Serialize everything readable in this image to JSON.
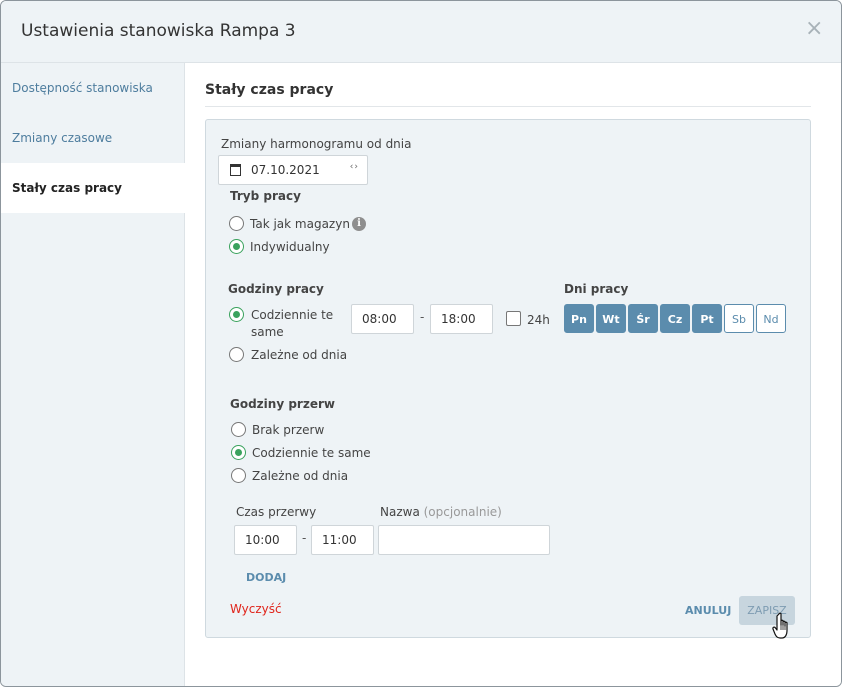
{
  "dialog": {
    "title": "Ustawienia stanowiska Rampa 3",
    "close_glyph": "×"
  },
  "sidebar": {
    "items": [
      {
        "label": "Dostępność stanowiska",
        "active": false
      },
      {
        "label": "Zmiany czasowe",
        "active": false
      },
      {
        "label": "Stały czas pracy",
        "active": true
      }
    ]
  },
  "main": {
    "section_title": "Stały czas pracy",
    "schedule_from": {
      "label": "Zmiany harmonogramu od dnia",
      "value": "07.10.2021",
      "arrows": "‹›"
    },
    "work_mode": {
      "heading": "Tryb pracy",
      "options": [
        {
          "label": "Tak jak magazyn",
          "checked": false
        },
        {
          "label": "Indywidualny",
          "checked": true
        }
      ],
      "info_glyph": "i"
    },
    "work_hours": {
      "heading": "Godziny pracy",
      "option_same_line1": "Codziennie te",
      "option_same_line2": "same",
      "option_daily": "Zależne od dnia",
      "from": "08:00",
      "dash": "-",
      "to": "18:00",
      "allday_label": "24h"
    },
    "work_days": {
      "heading": "Dni pracy",
      "days": [
        {
          "label": "Pn",
          "on": true
        },
        {
          "label": "Wt",
          "on": true
        },
        {
          "label": "Śr",
          "on": true
        },
        {
          "label": "Cz",
          "on": true
        },
        {
          "label": "Pt",
          "on": true
        },
        {
          "label": "Sb",
          "on": false
        },
        {
          "label": "Nd",
          "on": false
        }
      ]
    },
    "breaks": {
      "heading": "Godziny przerw",
      "options": [
        {
          "label": "Brak przerw",
          "checked": false
        },
        {
          "label": "Codziennie te same",
          "checked": true
        },
        {
          "label": "Zależne od dnia",
          "checked": false
        }
      ],
      "duration_label": "Czas przerwy",
      "name_label": "Nazwa",
      "name_optional": "(opcjonalnie)",
      "from": "10:00",
      "dash": "-",
      "to": "11:00",
      "name_value": "",
      "add_label": "DODAJ"
    },
    "footer": {
      "clear_label": "Wyczyść",
      "cancel_label": "ANULUJ",
      "save_label": "ZAPISZ"
    }
  },
  "colors": {
    "accent": "#5b8cad",
    "radio_checked": "#3aa25d",
    "danger": "#e0241b",
    "panel_bg": "#eef3f6"
  },
  "icons": [
    "close-icon",
    "calendar-icon",
    "info-icon",
    "hand-cursor-icon"
  ]
}
